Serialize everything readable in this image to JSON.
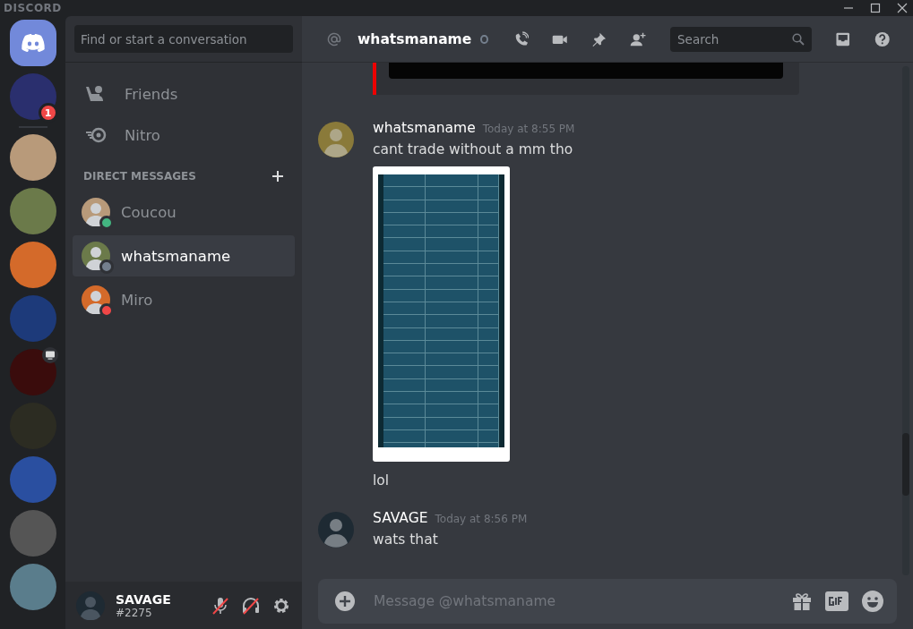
{
  "window": {
    "title": "DISCORD"
  },
  "servers": [
    {
      "kind": "home"
    },
    {
      "kind": "photo",
      "badge": "1",
      "streaming": false
    },
    {
      "kind": "separator"
    },
    {
      "kind": "photo",
      "streaming": false
    },
    {
      "kind": "photo",
      "streaming": false
    },
    {
      "kind": "photo",
      "streaming": false
    },
    {
      "kind": "photo",
      "streaming": false
    },
    {
      "kind": "photo",
      "streaming": true
    },
    {
      "kind": "photo",
      "streaming": false
    },
    {
      "kind": "photo",
      "streaming": false
    },
    {
      "kind": "photo",
      "streaming": false
    },
    {
      "kind": "photo",
      "streaming": false
    }
  ],
  "sidebar": {
    "search": {
      "placeholder": "Find or start a conversation"
    },
    "nav": [
      {
        "kind": "friends",
        "label": "Friends"
      },
      {
        "kind": "nitro",
        "label": "Nitro"
      }
    ],
    "section_title": "DIRECT MESSAGES",
    "dms": [
      {
        "name": "Coucou",
        "color": "#43b581",
        "selected": false
      },
      {
        "name": "whatsmaname",
        "color": "#747f8d",
        "selected": true
      },
      {
        "name": "Miro",
        "color": "#f04747",
        "selected": false
      }
    ],
    "user": {
      "name": "SAVAGE",
      "tag": "#2275",
      "muted": true,
      "deafened": true
    }
  },
  "header": {
    "name": "whatsmaname",
    "color": "#747f8d",
    "search": {
      "placeholder": "Search"
    }
  },
  "messages": [
    {
      "author": "whatsmaname",
      "time": "Today at 8:55 PM",
      "lines": [
        {
          "kind": "text",
          "text": "cant trade without a mm tho"
        },
        {
          "kind": "image"
        },
        {
          "kind": "text",
          "text": "lol"
        }
      ]
    },
    {
      "author": "SAVAGE",
      "time": "Today at 8:56 PM",
      "lines": [
        {
          "kind": "text",
          "text": "wats that"
        }
      ]
    }
  ],
  "composer": {
    "placeholder": "Message @whatsmaname"
  }
}
